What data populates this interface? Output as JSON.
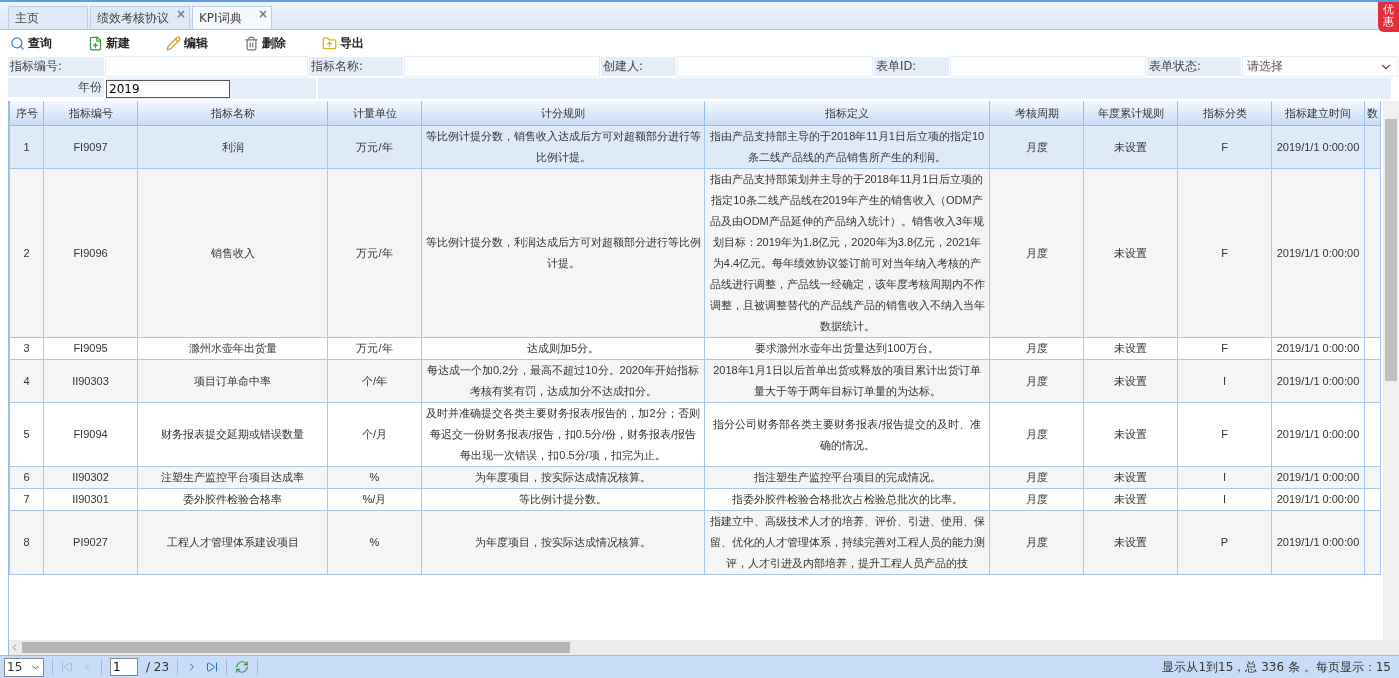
{
  "tabs": [
    {
      "label": "主页",
      "selected": false
    },
    {
      "label": "绩效考核协议",
      "selected": false,
      "close": "×"
    },
    {
      "label": "KPI词典",
      "selected": true,
      "close": "×"
    }
  ],
  "promo_badge": "优惠",
  "toolbar": [
    {
      "kind": "search",
      "label": "查询"
    },
    {
      "kind": "new",
      "label": "新建"
    },
    {
      "kind": "edit",
      "label": "编辑"
    },
    {
      "kind": "delete",
      "label": "删除"
    },
    {
      "kind": "export",
      "label": "导出"
    }
  ],
  "filters": {
    "row_1": [
      {
        "label": "指标编号:",
        "kind": "text"
      },
      {
        "label": "指标名称:",
        "kind": "text"
      },
      {
        "label": "创建人:",
        "kind": "text"
      },
      {
        "label": "表单ID:",
        "kind": "text"
      },
      {
        "label": "表单状态:",
        "kind": "select",
        "placeholder": "请选择"
      }
    ],
    "year": {
      "label": "年份",
      "value": "2019"
    }
  },
  "table": {
    "columns": [
      "序号",
      "指标编号",
      "指标名称",
      "计量单位",
      "计分规则",
      "指标定义",
      "考核周期",
      "年度累计规则",
      "指标分类",
      "指标建立时间",
      "数"
    ],
    "rows": [
      {
        "selected": true,
        "cells": [
          "1",
          "FI9097",
          "利润",
          "万元/年",
          "等比例计提分数，销售收入达成后方可对超额部分进行等比例计提。",
          "指由产品支持部主导的于2018年11月1日后立项的指定10条二线产品线的产品销售所产生的利润。",
          "月度",
          "未设置",
          "F",
          "2019/1/1 0:00:00"
        ]
      },
      {
        "selected": false,
        "cells": [
          "2",
          "FI9096",
          "销售收入",
          "万元/年",
          "等比例计提分数，利润达成后方可对超额部分进行等比例计提。",
          "指由产品支持部策划并主导的于2018年11月1日后立项的指定10条二线产品线在2019年产生的销售收入（ODM产品及由ODM产品延伸的产品纳入统计）。销售收入3年规划目标：2019年为1.8亿元，2020年为3.8亿元，2021年为4.4亿元。每年绩效协议签订前可对当年纳入考核的产品线进行调整，产品线一经确定，该年度考核周期内不作调整，且被调整替代的产品线产品的销售收入不纳入当年数据统计。",
          "月度",
          "未设置",
          "F",
          "2019/1/1 0:00:00"
        ]
      },
      {
        "selected": false,
        "cells": [
          "3",
          "FI9095",
          "滁州水壶年出货量",
          "万元/年",
          "达成则加5分。",
          "要求滁州水壶年出货量达到100万台。",
          "月度",
          "未设置",
          "F",
          "2019/1/1 0:00:00"
        ]
      },
      {
        "selected": false,
        "cells": [
          "4",
          "II90303",
          "项目订单命中率",
          "个/年",
          "每达成一个加0.2分，最高不超过10分。2020年开始指标考核有奖有罚，达成加分不达成扣分。",
          "2018年1月1日以后首单出货或释放的项目累计出货订单量大于等于两年目标订单量的为达标。",
          "月度",
          "未设置",
          "I",
          "2019/1/1 0:00:00"
        ]
      },
      {
        "selected": false,
        "cells": [
          "5",
          "FI9094",
          "财务报表提交延期或错误数量",
          "个/月",
          "及时并准确提交各类主要财务报表/报告的，加2分；否则每迟交一份财务报表/报告，扣0.5分/份，财务报表/报告每出现一次错误，扣0.5分/项，扣完为止。",
          "指分公司财务部各类主要财务报表/报告提交的及时、准确的情况。",
          "月度",
          "未设置",
          "F",
          "2019/1/1 0:00:00"
        ]
      },
      {
        "selected": false,
        "cells": [
          "6",
          "II90302",
          "注塑生产监控平台项目达成率",
          "%",
          "为年度项目，按实际达成情况核算。",
          "指注塑生产监控平台项目的完成情况。",
          "月度",
          "未设置",
          "I",
          "2019/1/1 0:00:00"
        ]
      },
      {
        "selected": false,
        "cells": [
          "7",
          "II90301",
          "委外胶件检验合格率",
          "%/月",
          "等比例计提分数。",
          "指委外胶件检验合格批次占检验总批次的比率。",
          "月度",
          "未设置",
          "I",
          "2019/1/1 0:00:00"
        ]
      },
      {
        "selected": false,
        "cells": [
          "8",
          "PI9027",
          "工程人才管理体系建设项目",
          "%",
          "为年度项目，按实际达成情况核算。",
          "指建立中、高级技术人才的培养、评价、引进、使用、保留、优化的人才管理体系，持续完善对工程人员的能力测评，人才引进及内部培养，提升工程人员产品的技",
          "月度",
          "未设置",
          "P",
          "2019/1/1 0:00:00"
        ]
      }
    ]
  },
  "pager": {
    "page_size": "15",
    "page": "1",
    "total_pages": "/ 23",
    "status": "显示从1到15，总 336 条 。每页显示：15"
  }
}
